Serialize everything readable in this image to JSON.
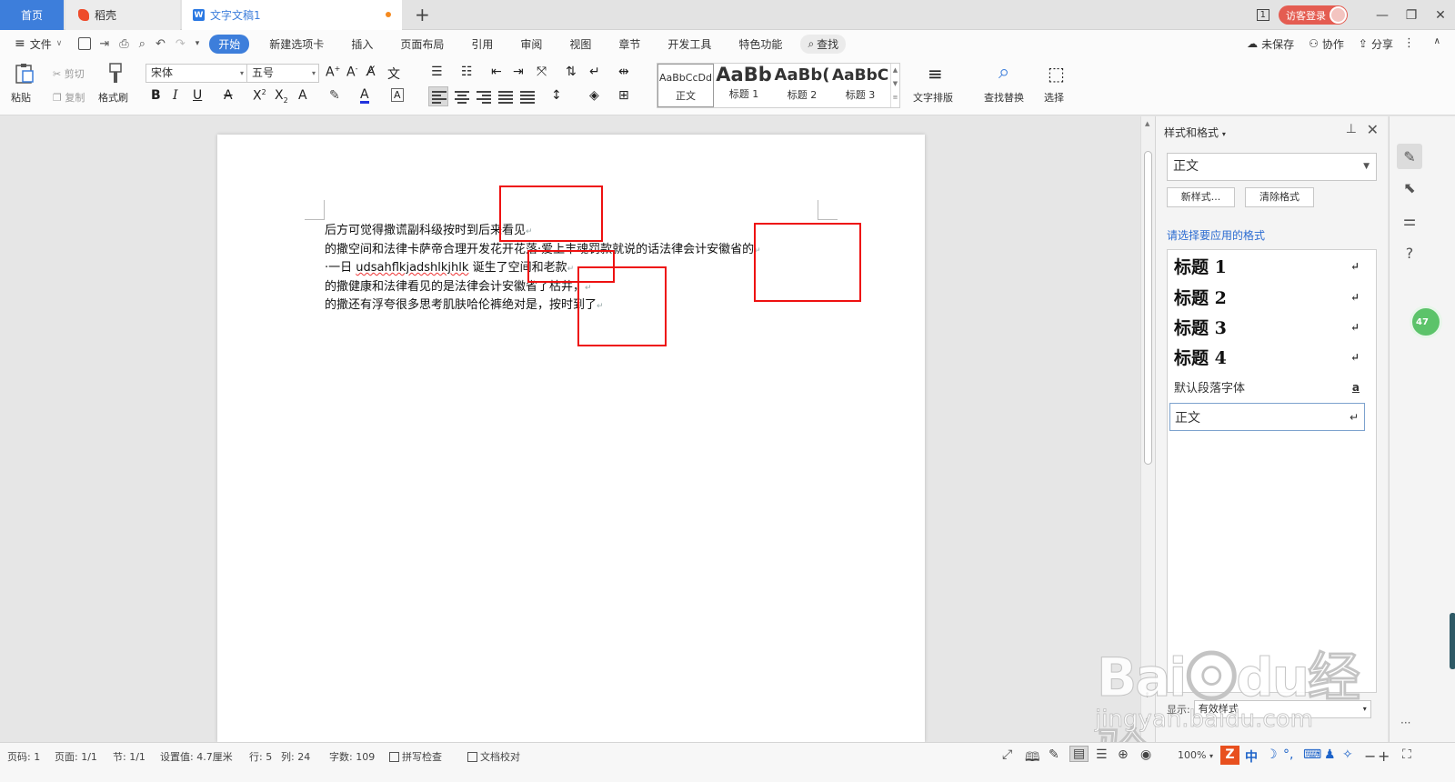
{
  "titlebar": {
    "tabs": [
      {
        "label": "首页"
      },
      {
        "label": "稻壳"
      },
      {
        "label": "文字文稿1"
      }
    ],
    "new_tab": "+",
    "window_count": "1",
    "login": "访客登录",
    "minimize": "—",
    "restore": "❐",
    "close": "✕"
  },
  "menubar": {
    "file": "文件",
    "items": [
      "开始",
      "新建选项卡",
      "插入",
      "页面布局",
      "引用",
      "审阅",
      "视图",
      "章节",
      "开发工具",
      "特色功能"
    ],
    "search": "查找",
    "right": [
      "未保存",
      "协作",
      "分享"
    ]
  },
  "ribbon": {
    "paste": "粘贴",
    "cut": "剪切",
    "copy": "复制",
    "format_painter": "格式刷",
    "font_name": "宋体",
    "font_size": "五号",
    "styles": [
      {
        "preview": "AaBbCcDd",
        "label": "正文"
      },
      {
        "preview": "AaBb",
        "label": "标题 1"
      },
      {
        "preview": "AaBb(",
        "label": "标题 2"
      },
      {
        "preview": "AaBbC",
        "label": "标题 3"
      }
    ],
    "text_layout": "文字排版",
    "find_replace": "查找替换",
    "select": "选择"
  },
  "document": {
    "lines": [
      "后方可觉得撒谎副科级按时到后来看见",
      "的撒空间和法律卡萨帝合理开发花开花落·爱上丰魂罚款就说的话法律会计安徽省的",
      "·一日 ",
      "的撒健康和法律看见的是法律会计安徽省了枯井，",
      "的撒还有浮夸很多思考肌肤哈伦裤绝对是，按时到了"
    ],
    "line3_latin": "udsahflkjadshlkjhlk",
    "line3_tail": " 诞生了空间和老款",
    "para_mark": "↵"
  },
  "styles_panel": {
    "title": "样式和格式",
    "current_style": "正文",
    "new_style": "新样式...",
    "clear_format": "清除格式",
    "apply_label": "请选择要应用的格式",
    "items": [
      {
        "label": "标题  1"
      },
      {
        "label": "标题  2"
      },
      {
        "label": "标题  3"
      },
      {
        "label": "标题  4"
      },
      {
        "label": "默认段落字体"
      },
      {
        "label": "正文"
      }
    ],
    "show_label": "显示:",
    "show_value": "有效样式"
  },
  "rail": {
    "badge": "47"
  },
  "watermark": {
    "big": "Bai⦿du经验",
    "small": "jingyan.baidu.com"
  },
  "statusbar": {
    "page_no": "页码: 1",
    "pages": "页面: 1/1",
    "section": "节: 1/1",
    "setting": "设置值: 4.7厘米",
    "row": "行: 5",
    "col": "列: 24",
    "words": "字数: 109",
    "spell": "拼写检查",
    "proof": "文档校对",
    "zoom": "100%"
  }
}
